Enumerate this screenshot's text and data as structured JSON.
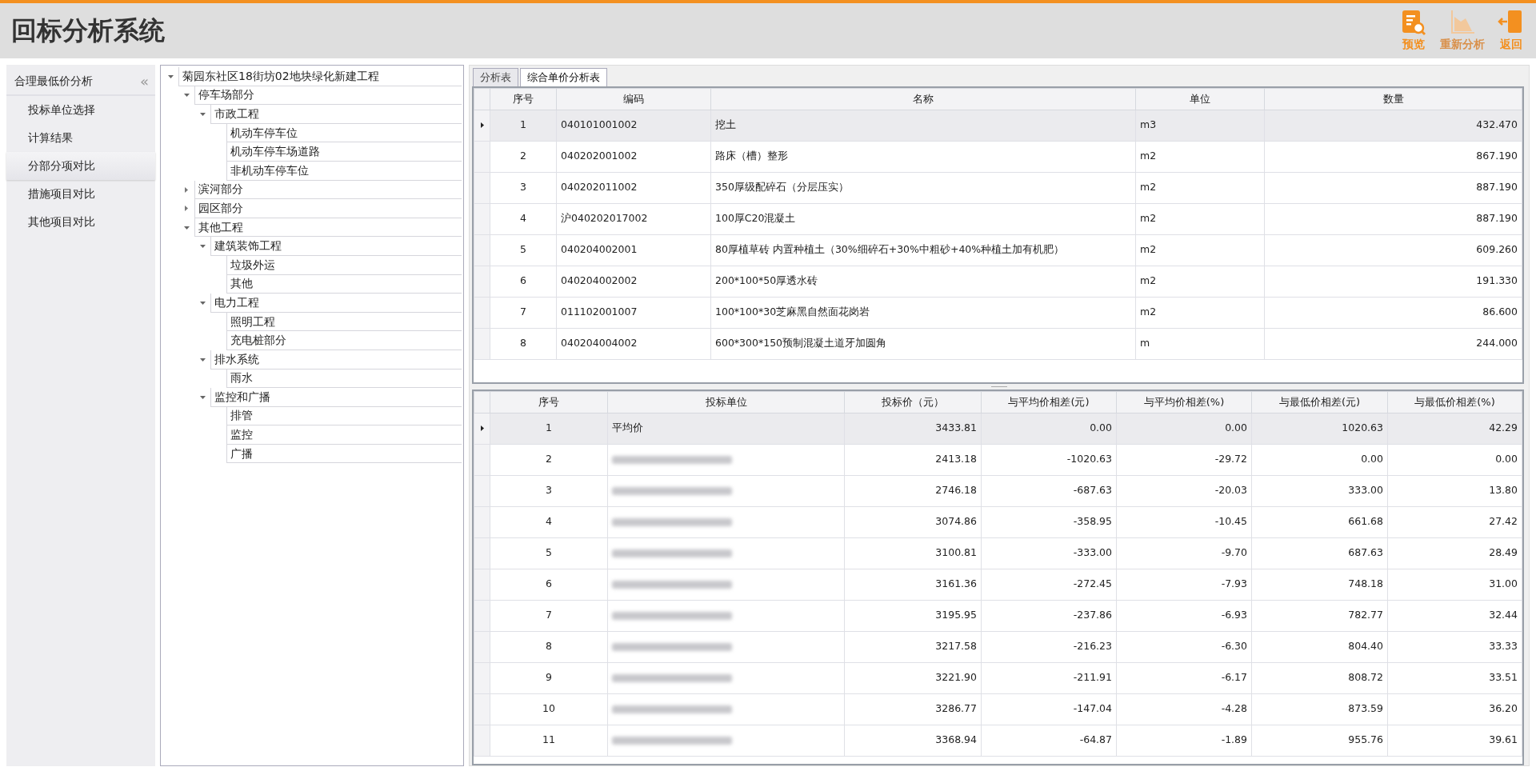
{
  "window": {
    "title": "回标分析系统"
  },
  "toolbar": [
    {
      "label": "预览",
      "kind": "preview",
      "disabled": false
    },
    {
      "label": "重新分析",
      "kind": "chart",
      "disabled": true
    },
    {
      "label": "返回",
      "kind": "exit",
      "disabled": false
    }
  ],
  "sidebar": {
    "heading": "合理最低价分析",
    "collapse_glyph": "«",
    "items": [
      {
        "label": "投标单位选择",
        "selected": false
      },
      {
        "label": "计算结果",
        "selected": false
      },
      {
        "label": "分部分项对比",
        "selected": true
      },
      {
        "label": "措施项目对比",
        "selected": false
      },
      {
        "label": "其他项目对比",
        "selected": false
      }
    ]
  },
  "tree": [
    {
      "label": "菊园东社区18街坊02地块绿化新建工程",
      "expanded": true,
      "children": [
        {
          "label": "停车场部分",
          "expanded": true,
          "children": [
            {
              "label": "市政工程",
              "expanded": true,
              "children": [
                {
                  "label": "机动车停车位"
                },
                {
                  "label": "机动车停车场道路"
                },
                {
                  "label": "非机动车停车位"
                }
              ]
            }
          ]
        },
        {
          "label": "滨河部分",
          "expanded": false
        },
        {
          "label": "园区部分",
          "expanded": false
        },
        {
          "label": "其他工程",
          "expanded": true,
          "children": [
            {
              "label": "建筑装饰工程",
              "expanded": true,
              "children": [
                {
                  "label": "垃圾外运"
                },
                {
                  "label": "其他"
                }
              ]
            },
            {
              "label": "电力工程",
              "expanded": true,
              "children": [
                {
                  "label": "照明工程"
                },
                {
                  "label": "充电桩部分"
                }
              ]
            },
            {
              "label": "排水系统",
              "expanded": true,
              "children": [
                {
                  "label": "雨水"
                }
              ]
            },
            {
              "label": "监控和广播",
              "expanded": true,
              "children": [
                {
                  "label": "排管"
                },
                {
                  "label": "监控"
                },
                {
                  "label": "广播"
                }
              ]
            }
          ]
        }
      ]
    }
  ],
  "tabs": [
    {
      "label": "分析表",
      "selected": false
    },
    {
      "label": "综合单价分析表",
      "selected": true
    }
  ],
  "items_table": {
    "columns": [
      "序号",
      "编码",
      "名称",
      "单位",
      "数量"
    ],
    "rows": [
      {
        "selected": true,
        "cells": [
          "1",
          "040101001002",
          "挖土",
          "m3",
          "432.470"
        ]
      },
      {
        "selected": false,
        "cells": [
          "2",
          "040202001002",
          "路床（槽）整形",
          "m2",
          "867.190"
        ]
      },
      {
        "selected": false,
        "cells": [
          "3",
          "040202011002",
          "350厚级配碎石（分层压实）",
          "m2",
          "887.190"
        ]
      },
      {
        "selected": false,
        "cells": [
          "4",
          "沪040202017002",
          "100厚C20混凝土",
          "m2",
          "887.190"
        ]
      },
      {
        "selected": false,
        "cells": [
          "5",
          "040204002001",
          "80厚植草砖 内置种植土（30%细碎石+30%中粗砂+40%种植土加有机肥）",
          "m2",
          "609.260"
        ]
      },
      {
        "selected": false,
        "cells": [
          "6",
          "040204002002",
          "200*100*50厚透水砖",
          "m2",
          "191.330"
        ]
      },
      {
        "selected": false,
        "cells": [
          "7",
          "011102001007",
          "100*100*30芝麻黑自然面花岗岩",
          "m2",
          "86.600"
        ]
      },
      {
        "selected": false,
        "cells": [
          "8",
          "040204004002",
          "600*300*150预制混凝土道牙加圆角",
          "m",
          "244.000"
        ]
      }
    ]
  },
  "bids_table": {
    "columns": [
      "序号",
      "投标单位",
      "投标价（元）",
      "与平均价相差(元)",
      "与平均价相差(%)",
      "与最低价相差(元)",
      "与最低价相差(%)"
    ],
    "rows": [
      {
        "selected": true,
        "no": "1",
        "bidder": "平均价",
        "values": [
          "3433.81",
          "0.00",
          "0.00",
          "1020.63",
          "42.29"
        ]
      },
      {
        "selected": false,
        "no": "2",
        "bidder_blurred": true,
        "values": [
          "2413.18",
          "-1020.63",
          "-29.72",
          "0.00",
          "0.00"
        ]
      },
      {
        "selected": false,
        "no": "3",
        "bidder_blurred": true,
        "values": [
          "2746.18",
          "-687.63",
          "-20.03",
          "333.00",
          "13.80"
        ]
      },
      {
        "selected": false,
        "no": "4",
        "bidder_blurred": true,
        "values": [
          "3074.86",
          "-358.95",
          "-10.45",
          "661.68",
          "27.42"
        ]
      },
      {
        "selected": false,
        "no": "5",
        "bidder_blurred": true,
        "values": [
          "3100.81",
          "-333.00",
          "-9.70",
          "687.63",
          "28.49"
        ]
      },
      {
        "selected": false,
        "no": "6",
        "bidder_blurred": true,
        "values": [
          "3161.36",
          "-272.45",
          "-7.93",
          "748.18",
          "31.00"
        ]
      },
      {
        "selected": false,
        "no": "7",
        "bidder_blurred": true,
        "values": [
          "3195.95",
          "-237.86",
          "-6.93",
          "782.77",
          "32.44"
        ]
      },
      {
        "selected": false,
        "no": "8",
        "bidder_blurred": true,
        "values": [
          "3217.58",
          "-216.23",
          "-6.30",
          "804.40",
          "33.33"
        ]
      },
      {
        "selected": false,
        "no": "9",
        "bidder_blurred": true,
        "values": [
          "3221.90",
          "-211.91",
          "-6.17",
          "808.72",
          "33.51"
        ]
      },
      {
        "selected": false,
        "no": "10",
        "bidder_blurred": true,
        "values": [
          "3286.77",
          "-147.04",
          "-4.28",
          "873.59",
          "36.20"
        ]
      },
      {
        "selected": false,
        "no": "11",
        "bidder_blurred": true,
        "values": [
          "3368.94",
          "-64.87",
          "-1.89",
          "955.76",
          "39.61"
        ]
      }
    ]
  }
}
